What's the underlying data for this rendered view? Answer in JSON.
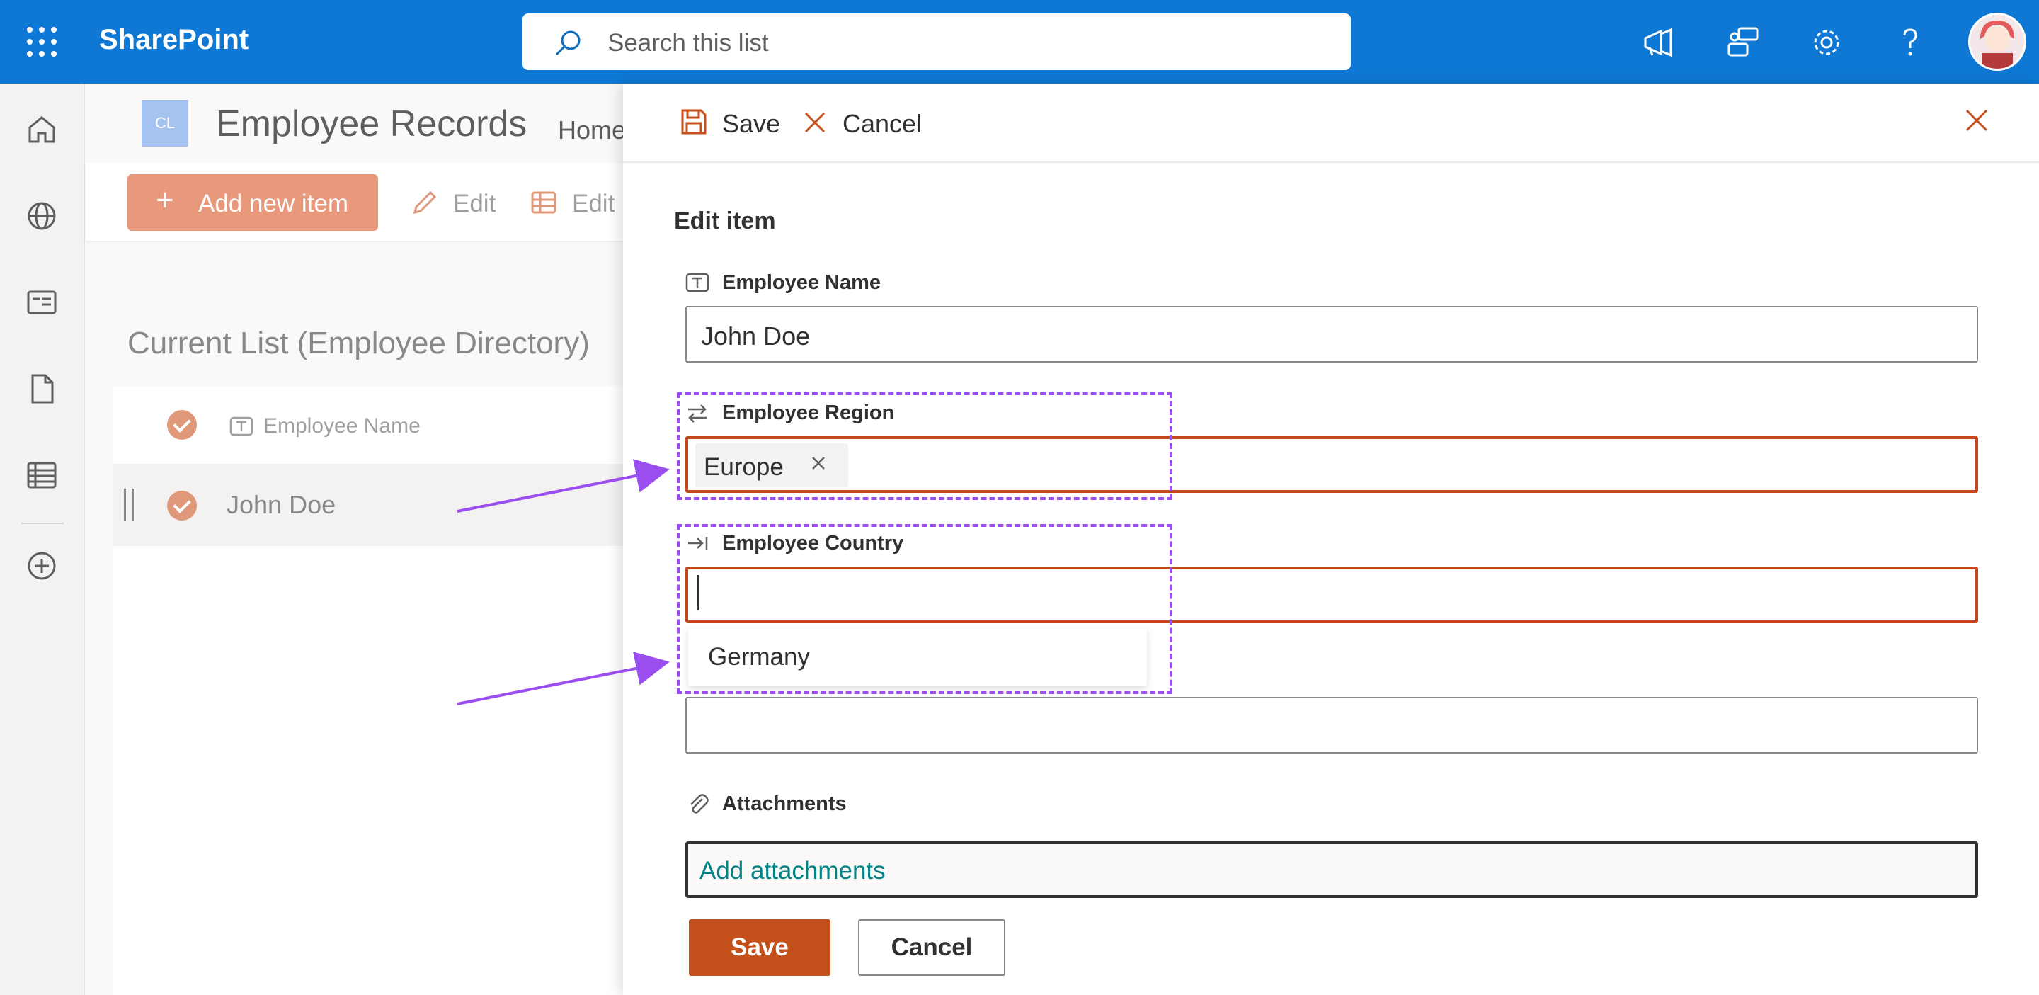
{
  "app": {
    "title": "SharePoint"
  },
  "search": {
    "placeholder": "Search this list"
  },
  "site": {
    "logo": "CL",
    "title": "Employee Records",
    "nav": "Home"
  },
  "commands": {
    "add_new": "Add new item",
    "edit": "Edit",
    "edit_grid": "Edit i"
  },
  "list": {
    "title": "Current List (Employee Directory)",
    "column": "Employee Name",
    "rows": [
      {
        "name": "John Doe"
      }
    ]
  },
  "panel": {
    "save": "Save",
    "cancel": "Cancel",
    "heading": "Edit item",
    "fields": {
      "name": {
        "label": "Employee Name",
        "value": "John Doe"
      },
      "region": {
        "label": "Employee Region",
        "chip": "Europe"
      },
      "country": {
        "label": "Employee Country",
        "value": "",
        "suggestion": "Germany"
      },
      "attachments": {
        "label": "Attachments",
        "link": "Add attachments"
      }
    },
    "footer": {
      "save": "Save",
      "cancel": "Cancel"
    }
  },
  "icons": [
    "waffle-icon",
    "search-icon",
    "megaphone-icon",
    "chat-icon",
    "gear-icon",
    "help-icon",
    "home-icon",
    "globe-icon",
    "news-icon",
    "file-icon",
    "list-icon",
    "add-icon",
    "save-icon",
    "close-icon",
    "text-field-icon",
    "lookup-icon",
    "choice-icon",
    "paperclip-icon"
  ],
  "colors": {
    "topbar": "#0f78d4",
    "accent": "#c4501c",
    "annotation": "#9b4ef0",
    "link": "#038387"
  }
}
